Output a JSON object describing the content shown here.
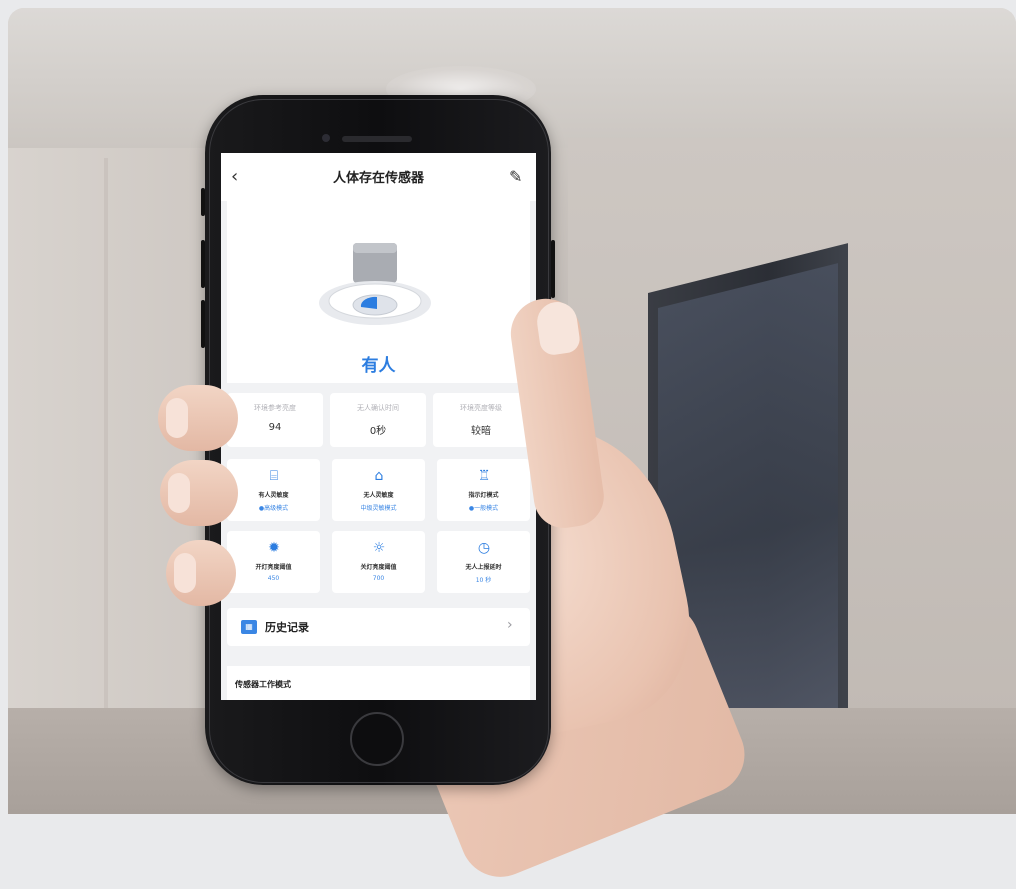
{
  "app": {
    "title": "人体存在传感器",
    "back_icon": "chevron-left-icon",
    "edit_icon": "edit-pencil-icon"
  },
  "device": {
    "status": "有人",
    "image": "ceiling-presence-sensor"
  },
  "info": [
    {
      "label": "环境参考亮度",
      "value": "94"
    },
    {
      "label": "无人确认时间",
      "value": "0秒"
    },
    {
      "label": "环境亮度等级",
      "value": "较暗"
    }
  ],
  "tiles": [
    {
      "icon": "presence-sensitivity-icon",
      "label": "有人灵敏度",
      "sub": "●高级模式"
    },
    {
      "icon": "home-sensitivity-icon",
      "label": "无人灵敏度",
      "sub": "中级灵敏模式"
    },
    {
      "icon": "indicator-light-icon",
      "label": "指示灯模式",
      "sub": "●一般模式"
    },
    {
      "icon": "sun-bright-icon",
      "label": "开灯亮度阈值",
      "sub": "450"
    },
    {
      "icon": "sun-dim-icon",
      "label": "关灯亮度阈值",
      "sub": "700"
    },
    {
      "icon": "timer-icon",
      "label": "无人上报延时",
      "sub": "10   秒"
    }
  ],
  "history": {
    "label": "历史记录",
    "icon": "calendar-icon",
    "arrow": "chevron-right-icon"
  },
  "mode": {
    "label": "传感器工作模式"
  },
  "colors": {
    "accent": "#2c7de0",
    "screen_bg": "#f1f2f4",
    "phone_body": "#111111"
  }
}
